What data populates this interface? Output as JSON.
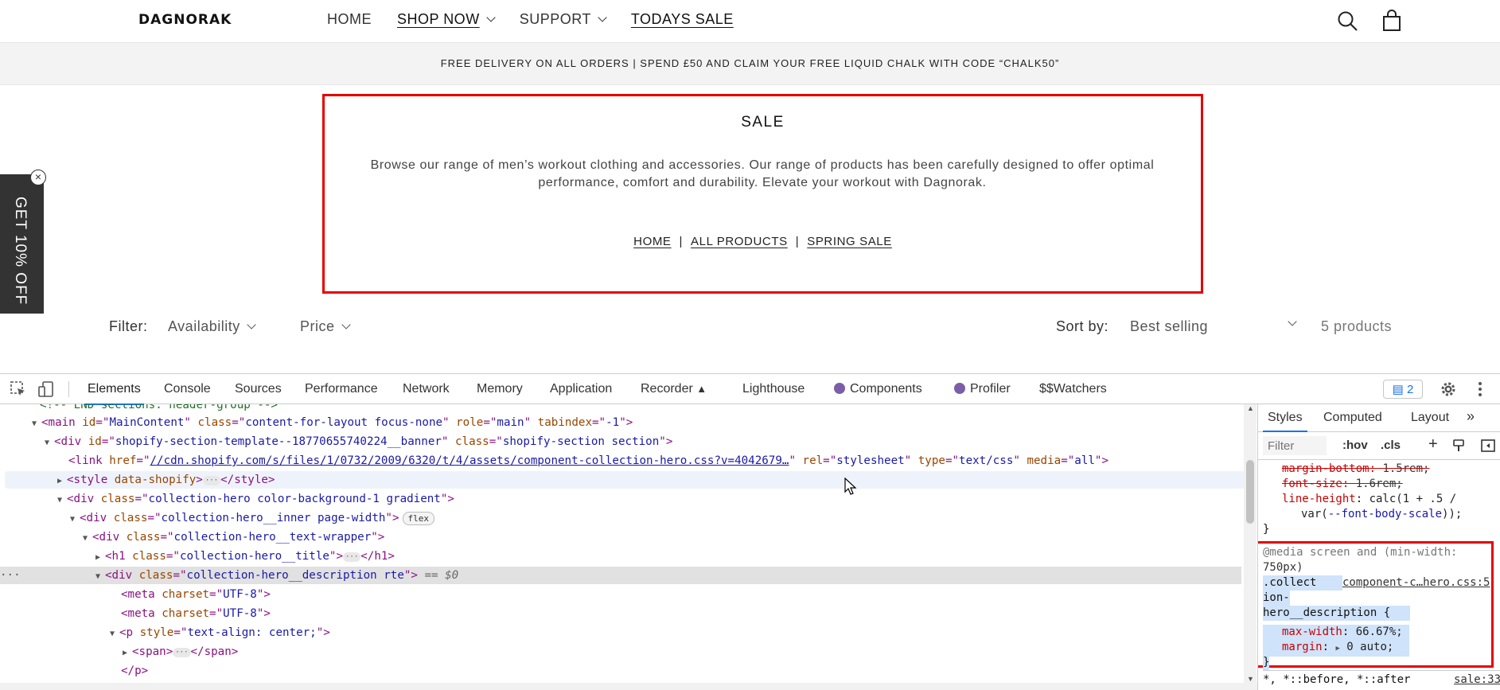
{
  "header": {
    "logo": "DAGNORAK",
    "nav": [
      {
        "label": "HOME",
        "dropdown": false,
        "underlined": false
      },
      {
        "label": "SHOP NOW",
        "dropdown": true,
        "underlined": true
      },
      {
        "label": "SUPPORT",
        "dropdown": true,
        "underlined": false
      },
      {
        "label": "TODAYS SALE",
        "dropdown": false,
        "underlined": true
      }
    ],
    "icons": [
      "search-icon",
      "cart-icon"
    ]
  },
  "announcement": "FREE DELIVERY ON ALL ORDERS | SPEND £50 AND CLAIM YOUR FREE LIQUID CHALK WITH CODE “CHALK50”",
  "hero": {
    "title": "SALE",
    "description": "Browse our range of men’s workout clothing and accessories. Our range of products has been carefully designed to offer optimal performance, comfort and durability. Elevate your workout with Dagnorak.",
    "breadcrumb": [
      "HOME",
      "ALL PRODUCTS",
      "SPRING SALE"
    ],
    "breadcrumb_sep": "|",
    "highlight_color": "#e60000"
  },
  "promo": {
    "text": "GET 10% OFF",
    "close": "×"
  },
  "filter": {
    "label": "Filter:",
    "availability": "Availability",
    "price": "Price",
    "sort_label": "Sort by:",
    "sort_value": "Best selling",
    "count": "5 products"
  },
  "devtools": {
    "tabs": [
      "Elements",
      "Console",
      "Sources",
      "Performance",
      "Network",
      "Memory",
      "Application",
      "Recorder",
      "Lighthouse",
      "Components",
      "Profiler",
      "$$Watchers"
    ],
    "active_tab": "Elements",
    "issues_count": "2",
    "dom": {
      "l0": "<!-- END sections: header-group -->",
      "l1_tag": "main",
      "l1_id": "MainContent",
      "l1_class": "content-for-layout focus-none",
      "l1_role": "main",
      "l1_tabindex": "-1",
      "l2_id": "shopify-section-template--18770655740224__banner",
      "l2_class": "shopify-section section",
      "l3_href": "//cdn.shopify.com/s/files/1/0732/2009/6320/t/4/assets/component-collection-hero.css?v=4042679…",
      "l3_rel": "stylesheet",
      "l3_type": "text/css",
      "l3_media": "all",
      "l4_attr": "data-shopify",
      "l5_class": "collection-hero color-background-1 gradient",
      "l6_class": "collection-hero__inner page-width",
      "l6_badge": "flex",
      "l7_class": "collection-hero__text-wrapper",
      "l8_class": "collection-hero__title",
      "l9_class": "collection-hero__description rte",
      "l9_suffix": "== $0",
      "l10_charset": "UTF-8",
      "l11_charset": "UTF-8",
      "l12_style": "text-align: center;",
      "dots": "···"
    },
    "styles": {
      "tabs": [
        "Styles",
        "Computed",
        "Layout"
      ],
      "more": "»",
      "filter_placeholder": "Filter",
      "hov": ":hov",
      ".cls": ".cls",
      "rule1": [
        {
          "prop": "margin-bottom",
          "value": "1.5rem;",
          "struck": true
        },
        {
          "prop": "font-size",
          "value": "1.6rem;",
          "struck": true
        },
        {
          "prop": "line-height",
          "value": "calc(1 + .5 /",
          "struck": false
        }
      ],
      "rule1_cont": "var(",
      "rule1_var": "--font-body-scale",
      "rule1_end": "));",
      "close_brace": "}",
      "media_query": "@media screen and (min-width:",
      "media_query2": "750px)",
      "selector1": ".collect",
      "selector2": "ion-",
      "selector3": "hero__description {",
      "source": "component-c…hero.css:5",
      "decl": [
        {
          "prop": "max-width",
          "value": "66.67%;"
        },
        {
          "prop": "margin",
          "value": "0 auto;"
        }
      ],
      "universal": "*, *::before, *::after",
      "universal_src": "sale:33"
    }
  }
}
